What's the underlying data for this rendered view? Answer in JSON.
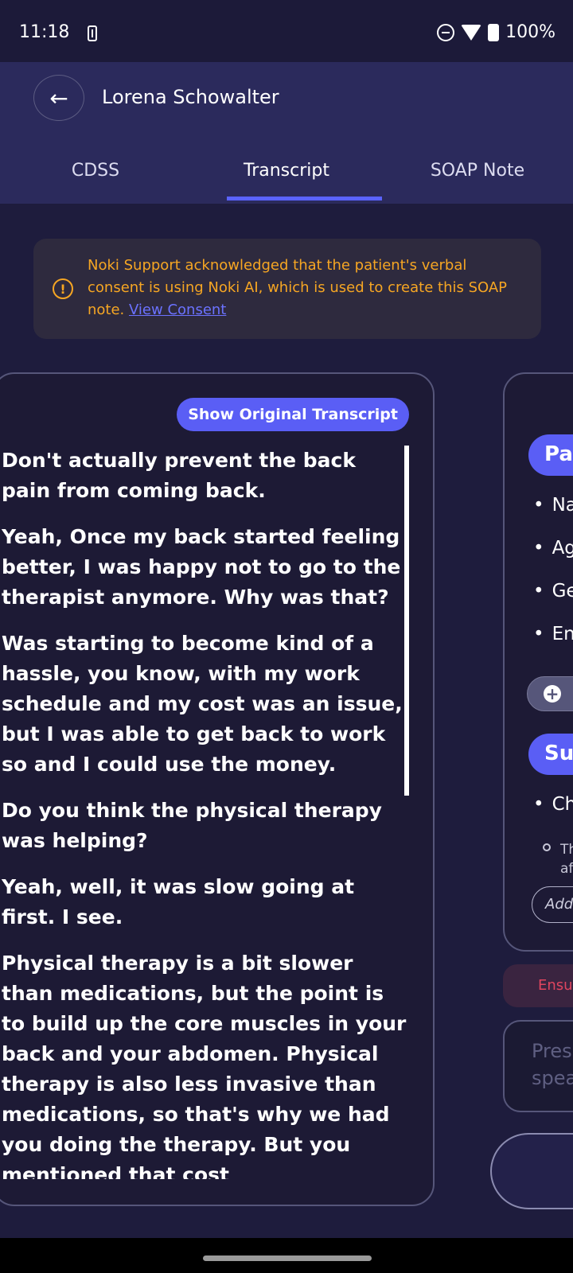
{
  "status_bar": {
    "time": "11:18",
    "battery": "100%"
  },
  "header": {
    "patient_name": "Lorena Schowalter",
    "tabs": [
      {
        "label": "CDSS"
      },
      {
        "label": "Transcript"
      },
      {
        "label": "SOAP Note"
      }
    ],
    "active_tab": "Transcript"
  },
  "consent_notice": {
    "text": "Noki Support acknowledged that the patient's verbal consent is using Noki AI, which is used to create this SOAP note.",
    "link_label": "View Consent",
    "accent_color": "#f6a623"
  },
  "transcript": {
    "show_original_label": "Show Original Transcript",
    "paragraphs": [
      "Don't actually prevent the back pain from coming back.",
      "Yeah, Once my back started feeling better, I was happy not to go to the therapist anymore. Why was that?",
      "Was starting to become kind of a hassle, you know, with my work schedule and my cost was an issue, but I was able to get back to work so and I could use the money.",
      "Do you think the physical therapy was helping?",
      "Yeah, well, it was slow going at first. I see.",
      "Physical therapy is a bit slower than medications, but the point is to build up the core muscles in your back and your abdomen. Physical therapy is also less invasive than medications, so that's why we had you doing the therapy. But you mentioned that cost"
    ]
  },
  "soap_preview": {
    "section_patient": "Pat",
    "patient_bullets": [
      "Na",
      "Ag",
      "Ge",
      "Enc"
    ],
    "section_subjective": "Sub",
    "subjective_bullets": [
      "Ch"
    ],
    "sub_bullet_line1": "Th",
    "sub_bullet_line2": "af",
    "add_placeholder": "Add"
  },
  "footer": {
    "ensure_text": "Ensu",
    "speak_placeholder_line1": "Pres",
    "speak_placeholder_line2": "spea"
  }
}
